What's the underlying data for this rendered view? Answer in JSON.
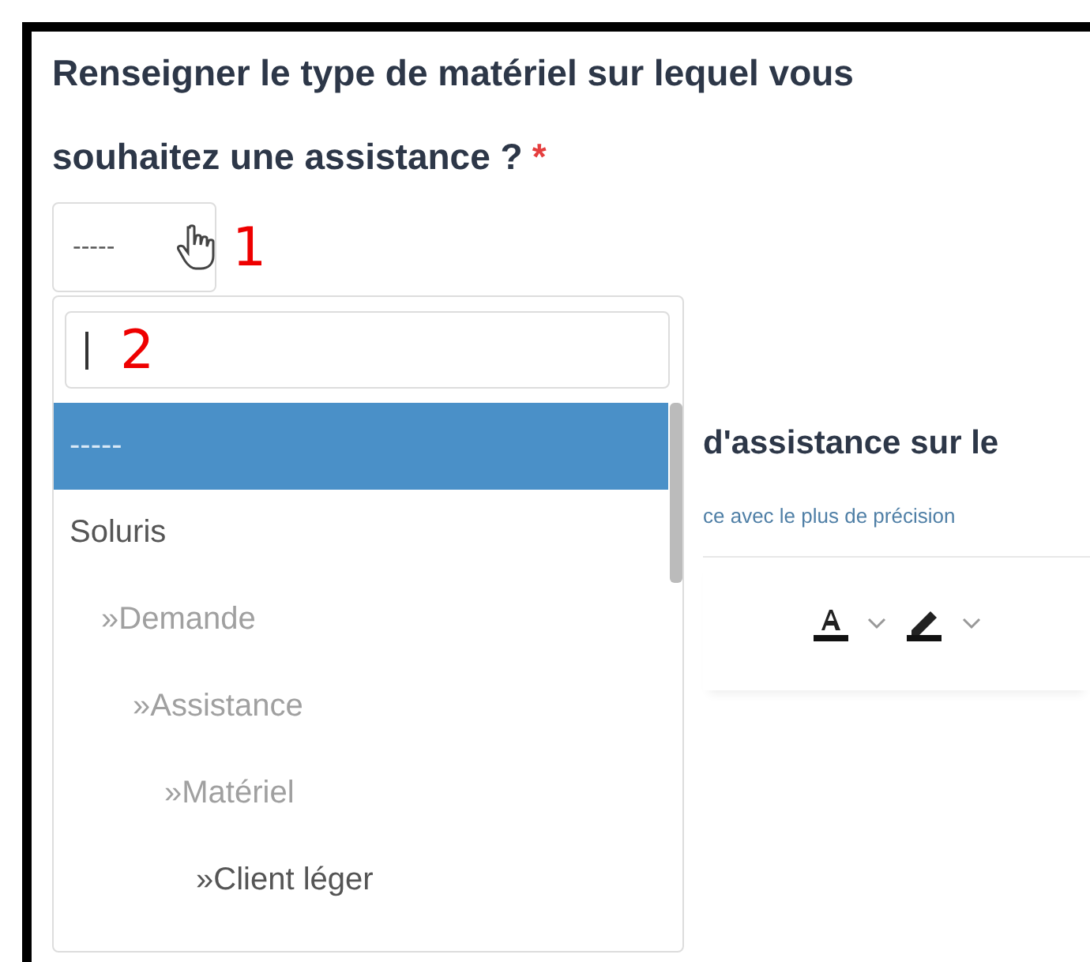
{
  "question": {
    "text": "Renseigner le type de matériel sur lequel vous souhaitez une assistance ?",
    "required_mark": "*"
  },
  "select": {
    "value": "-----",
    "callout": "1"
  },
  "dropdown": {
    "search": {
      "callout": "2"
    },
    "options": [
      {
        "label": "-----",
        "selected": true,
        "disabled": false
      },
      {
        "label": "Soluris",
        "selected": false,
        "disabled": false,
        "children": [
          {
            "label": "»Demande",
            "selected": false,
            "disabled": true,
            "children": [
              {
                "label": "»Assistance",
                "selected": false,
                "disabled": true,
                "children": [
                  {
                    "label": "»Matériel",
                    "selected": false,
                    "disabled": true,
                    "children": [
                      {
                        "label": "»Client léger",
                        "selected": false,
                        "disabled": false
                      }
                    ]
                  }
                ]
              }
            ]
          }
        ]
      }
    ]
  },
  "next_field": {
    "label": "d'assistance sur le",
    "hint": "ce avec le plus de précision"
  }
}
